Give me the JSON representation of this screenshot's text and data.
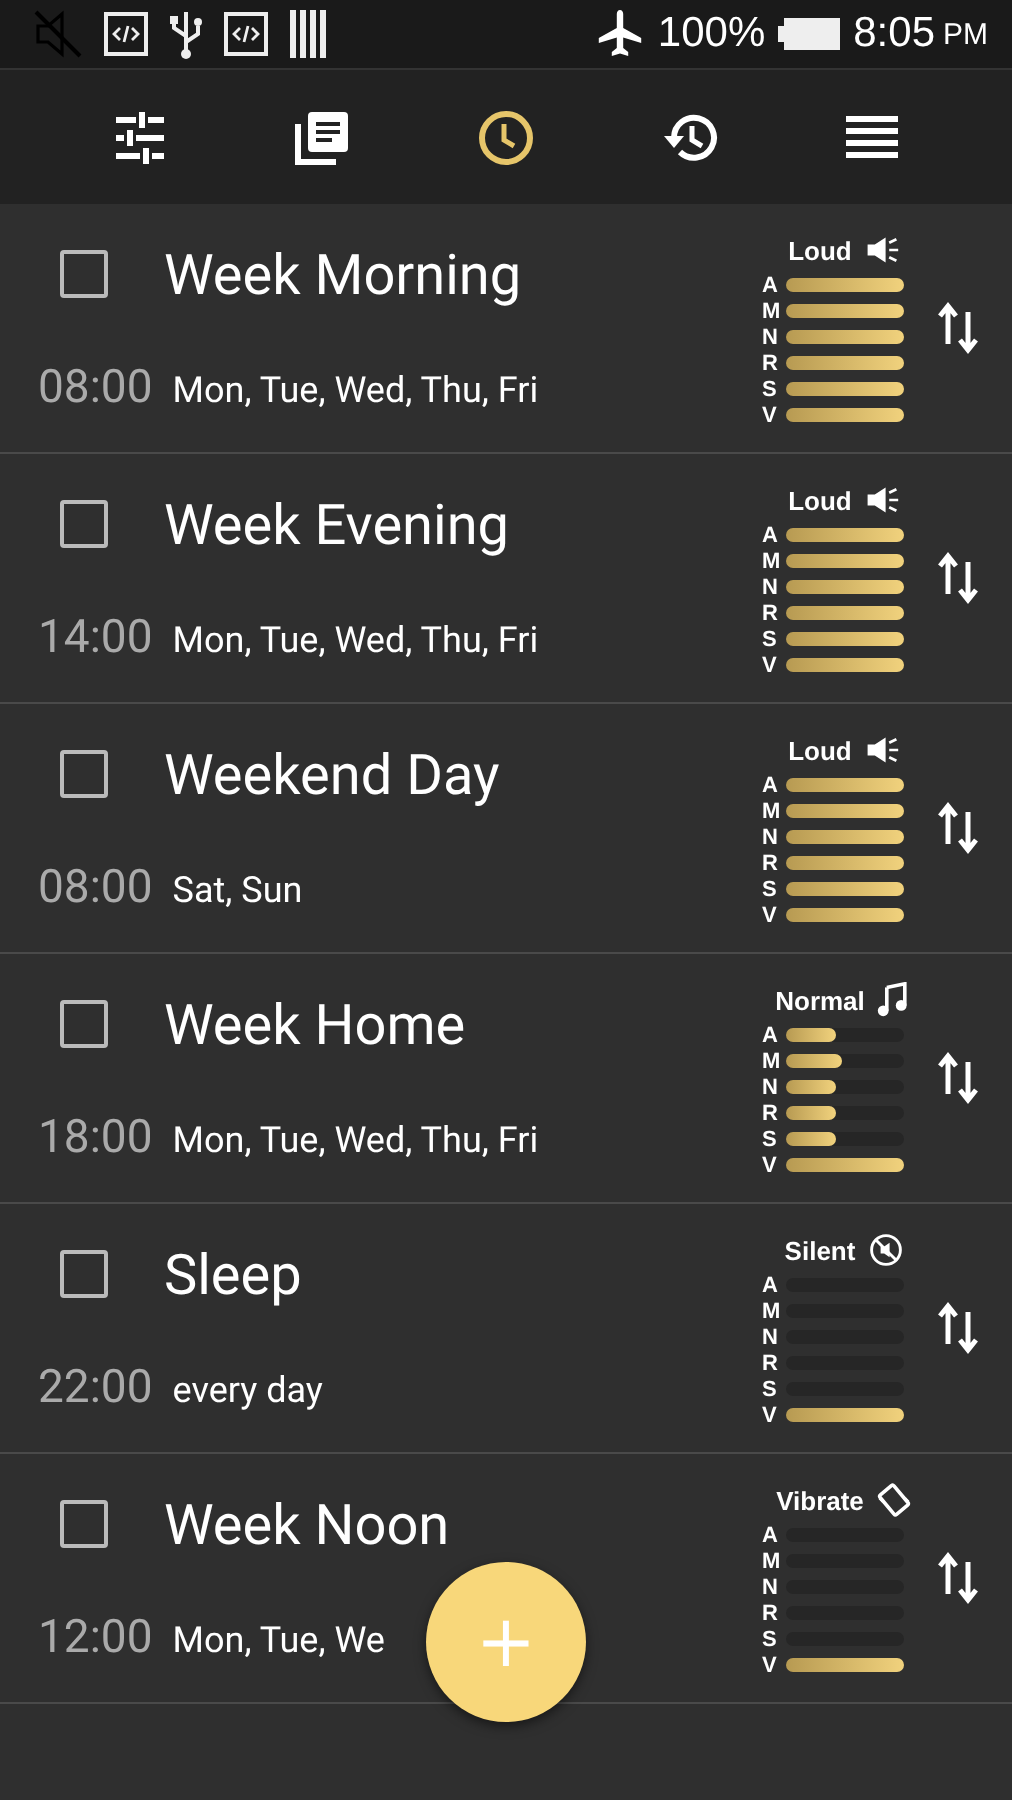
{
  "status_bar": {
    "battery": "100%",
    "time": "8:05",
    "ampm": "PM"
  },
  "tabs": [
    {
      "kind": "tune",
      "selected": false
    },
    {
      "kind": "library",
      "selected": false
    },
    {
      "kind": "clock",
      "selected": true
    },
    {
      "kind": "history",
      "selected": false
    },
    {
      "kind": "menu",
      "selected": false
    }
  ],
  "schedules": [
    {
      "checked": false,
      "title": "Week Morning",
      "time": "08:00",
      "days": "Mon, Tue, Wed, Thu, Fri",
      "mode": {
        "label": "Loud",
        "kind": "loud"
      },
      "channels": [
        {
          "letter": "A",
          "level": 1
        },
        {
          "letter": "M",
          "level": 1
        },
        {
          "letter": "N",
          "level": 1
        },
        {
          "letter": "R",
          "level": 1
        },
        {
          "letter": "S",
          "level": 1
        },
        {
          "letter": "V",
          "level": 1
        }
      ]
    },
    {
      "checked": false,
      "title": "Week Evening",
      "time": "14:00",
      "days": "Mon, Tue, Wed, Thu, Fri",
      "mode": {
        "label": "Loud",
        "kind": "loud"
      },
      "channels": [
        {
          "letter": "A",
          "level": 1
        },
        {
          "letter": "M",
          "level": 1
        },
        {
          "letter": "N",
          "level": 1
        },
        {
          "letter": "R",
          "level": 1
        },
        {
          "letter": "S",
          "level": 1
        },
        {
          "letter": "V",
          "level": 1
        }
      ]
    },
    {
      "checked": false,
      "title": "Weekend Day",
      "time": "08:00",
      "days": "Sat, Sun",
      "mode": {
        "label": "Loud",
        "kind": "loud"
      },
      "channels": [
        {
          "letter": "A",
          "level": 1
        },
        {
          "letter": "M",
          "level": 1
        },
        {
          "letter": "N",
          "level": 1
        },
        {
          "letter": "R",
          "level": 1
        },
        {
          "letter": "S",
          "level": 1
        },
        {
          "letter": "V",
          "level": 1
        }
      ]
    },
    {
      "checked": false,
      "title": "Week Home",
      "time": "18:00",
      "days": "Mon, Tue, Wed, Thu, Fri",
      "mode": {
        "label": "Normal",
        "kind": "normal"
      },
      "channels": [
        {
          "letter": "A",
          "level": 0.42
        },
        {
          "letter": "M",
          "level": 0.47
        },
        {
          "letter": "N",
          "level": 0.42
        },
        {
          "letter": "R",
          "level": 0.42
        },
        {
          "letter": "S",
          "level": 0.42
        },
        {
          "letter": "V",
          "level": 1
        }
      ]
    },
    {
      "checked": false,
      "title": "Sleep",
      "time": "22:00",
      "days": "every day",
      "mode": {
        "label": "Silent",
        "kind": "silent"
      },
      "channels": [
        {
          "letter": "A",
          "level": 0
        },
        {
          "letter": "M",
          "level": 0
        },
        {
          "letter": "N",
          "level": 0
        },
        {
          "letter": "R",
          "level": 0
        },
        {
          "letter": "S",
          "level": 0
        },
        {
          "letter": "V",
          "level": 1
        }
      ]
    },
    {
      "checked": false,
      "title": "Week Noon",
      "time": "12:00",
      "days": "Mon, Tue, We",
      "mode": {
        "label": "Vibrate",
        "kind": "vibrate"
      },
      "channels": [
        {
          "letter": "A",
          "level": 0
        },
        {
          "letter": "M",
          "level": 0
        },
        {
          "letter": "N",
          "level": 0
        },
        {
          "letter": "R",
          "level": 0
        },
        {
          "letter": "S",
          "level": 0
        },
        {
          "letter": "V",
          "level": 1
        }
      ]
    }
  ],
  "add_button": {
    "label": "+"
  }
}
